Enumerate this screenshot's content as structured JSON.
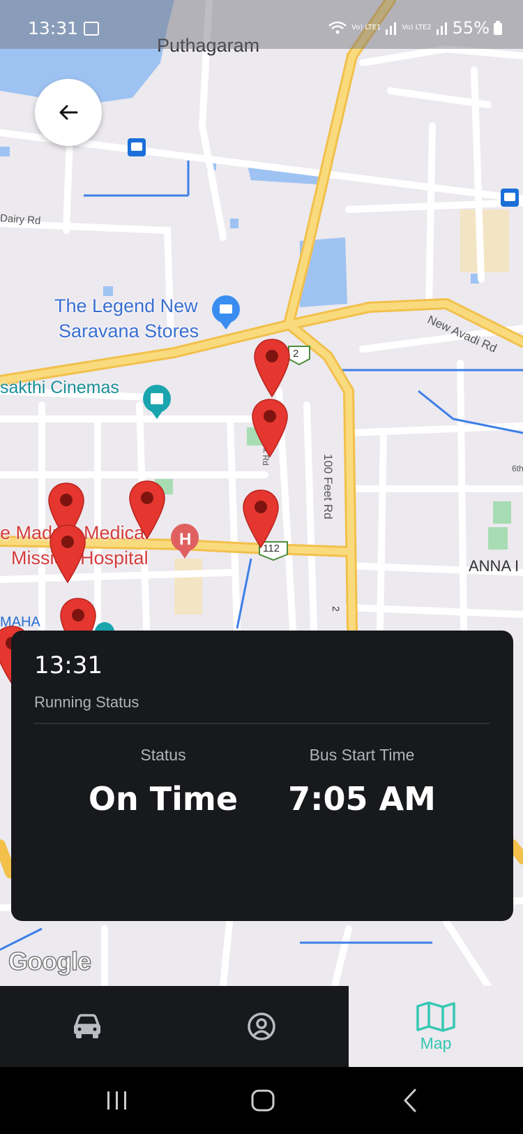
{
  "status_bar": {
    "time": "13:31",
    "sim1": "Vo) LTE1",
    "sim2": "Vo) LTE2",
    "battery": "55%"
  },
  "map": {
    "labels": {
      "locality": "Puthagaram",
      "dairy_rd": "Dairy Rd",
      "store_line1": "The Legend New",
      "store_line2": "Saravana Stores",
      "cinema": "sakthi Cinemas",
      "new_avadi_rd": "New Avadi Rd",
      "feet_rd": "100 Feet Rd",
      "hospital_line1": "e Madras Medical",
      "hospital_line2": "Mission Hospital",
      "anna": "ANNA I",
      "maha": "MAHA",
      "sixth": "6th",
      "route2": "2",
      "route112": "112",
      "route2b": "2",
      "k_rd": "k Rd"
    },
    "attribution": "Google"
  },
  "info_card": {
    "time": "13:31",
    "subtitle": "Running Status",
    "status_label": "Status",
    "status_value": "On Time",
    "start_label": "Bus Start Time",
    "start_value": "7:05 AM"
  },
  "bottom_nav": {
    "map_label": "Map",
    "active_color": "#35c8b2"
  }
}
